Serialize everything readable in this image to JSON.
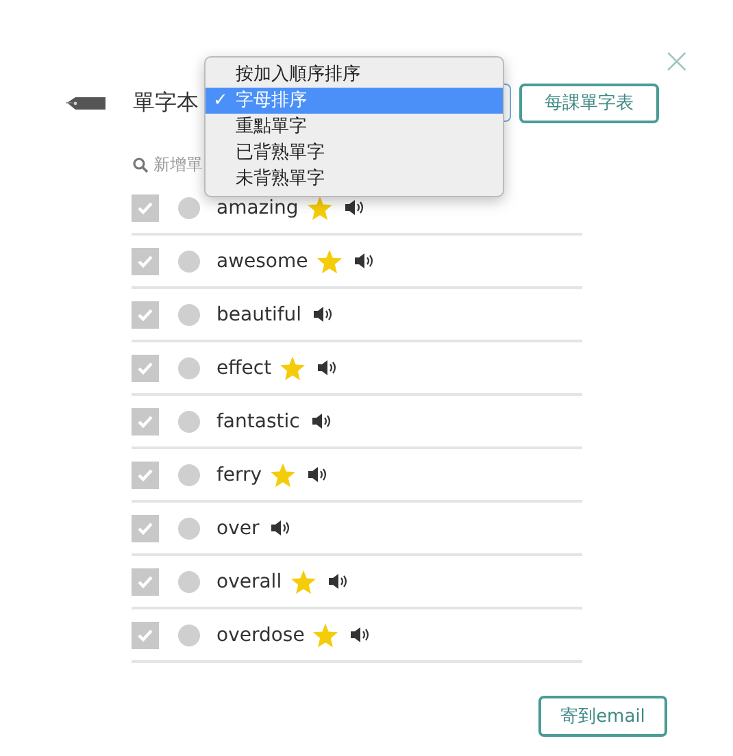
{
  "header": {
    "title": "單字本",
    "lessons_button": "每課單字表",
    "close": "×"
  },
  "sort_menu": [
    {
      "label": "按加入順序排序",
      "selected": false
    },
    {
      "label": "字母排序",
      "selected": true,
      "check": "✓"
    },
    {
      "label": "重點單字",
      "selected": false
    },
    {
      "label": "已背熟單字",
      "selected": false
    },
    {
      "label": "未背熟單字",
      "selected": false
    }
  ],
  "search": {
    "placeholder": "新增單"
  },
  "words": [
    {
      "word": "amazing",
      "checked": true,
      "starred": true
    },
    {
      "word": "awesome",
      "checked": true,
      "starred": true
    },
    {
      "word": "beautiful",
      "checked": true,
      "starred": false
    },
    {
      "word": "effect",
      "checked": true,
      "starred": true
    },
    {
      "word": "fantastic",
      "checked": true,
      "starred": false
    },
    {
      "word": "ferry",
      "checked": true,
      "starred": true
    },
    {
      "word": "over",
      "checked": true,
      "starred": false
    },
    {
      "word": "overall",
      "checked": true,
      "starred": true
    },
    {
      "word": "overdose",
      "checked": true,
      "starred": true
    }
  ],
  "email_button": "寄到email"
}
